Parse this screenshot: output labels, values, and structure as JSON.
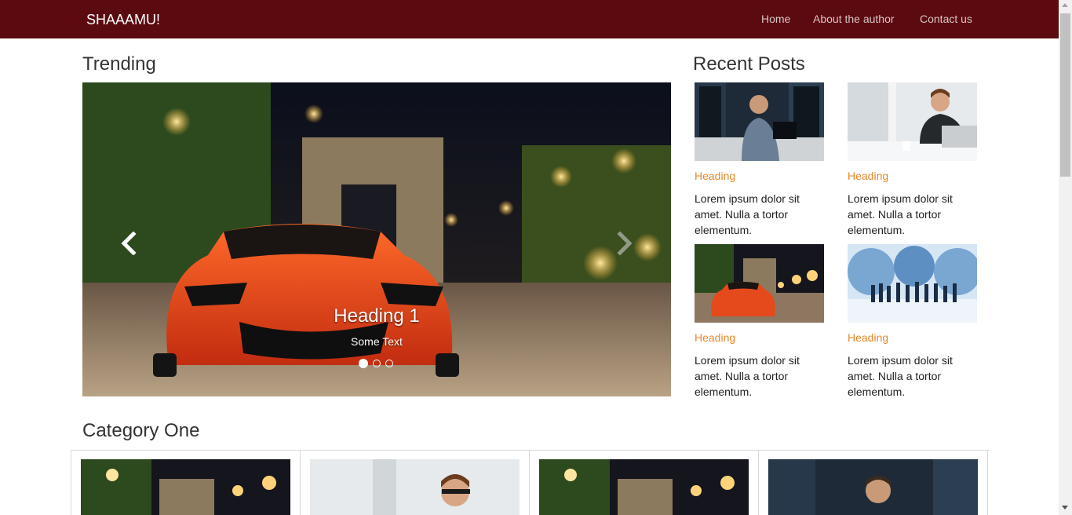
{
  "navbar": {
    "brand": "SHAAAMU!",
    "links": [
      "Home",
      "About the author",
      "Contact us"
    ],
    "background_color": "#5b0a10"
  },
  "trending": {
    "title": "Trending",
    "slide": {
      "heading": "Heading 1",
      "text": "Some Text",
      "image": "car-photo"
    },
    "indicator_count": 3,
    "active_indicator": 1,
    "controls": [
      "chevron-left-icon",
      "chevron-right-icon"
    ]
  },
  "recent": {
    "title": "Recent Posts",
    "posts": [
      {
        "heading": "Heading",
        "text": "Lorem ipsum dolor sit amet. Nulla a tortor elementum.",
        "image": "server-room-photo"
      },
      {
        "heading": "Heading",
        "text": "Lorem ipsum dolor sit amet. Nulla a tortor elementum.",
        "image": "man-laptop-photo"
      },
      {
        "heading": "Heading",
        "text": "Lorem ipsum dolor sit amet. Nulla a tortor elementum.",
        "image": "car-photo"
      },
      {
        "heading": "Heading",
        "text": "Lorem ipsum dolor sit amet. Nulla a tortor elementum.",
        "image": "globe-business-photo"
      }
    ],
    "heading_color": "#e8882b"
  },
  "category": {
    "title": "Category One",
    "cards": [
      {
        "image": "car-photo"
      },
      {
        "image": "man-laptop-photo"
      },
      {
        "image": "car-photo"
      },
      {
        "image": "server-room-photo"
      }
    ]
  }
}
